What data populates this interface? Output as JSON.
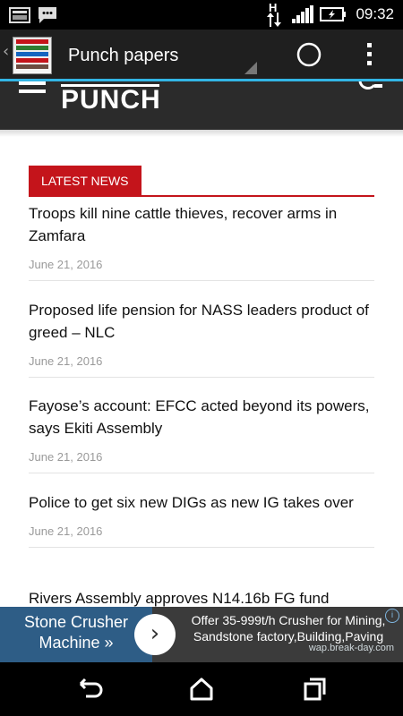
{
  "status_bar": {
    "time": "09:32",
    "signal_letter": "H",
    "icons": [
      "screenshot-icon",
      "chat-icon",
      "data-arrows-icon",
      "signal-icon",
      "battery-icon"
    ]
  },
  "action_bar": {
    "title": "Punch papers",
    "icons": [
      "app-thumbnail-icon",
      "refresh-circle-icon",
      "overflow-menu-icon"
    ]
  },
  "site_header": {
    "logo": "PUNCH",
    "icons": [
      "hamburger-menu-icon",
      "search-icon"
    ]
  },
  "section": {
    "label": "LATEST NEWS"
  },
  "articles": [
    {
      "headline": "Troops kill nine cattle thieves, recover arms in Zamfara",
      "date": "June 21, 2016"
    },
    {
      "headline": "Proposed life pension for NASS leaders product of greed – NLC",
      "date": "June 21, 2016"
    },
    {
      "headline": "Fayose’s account: EFCC acted beyond its powers, says Ekiti Assembly",
      "date": "June 21, 2016"
    },
    {
      "headline": "Police to get six new DIGs as new IG takes over",
      "date": "June 21, 2016"
    },
    {
      "headline": "Rivers Assembly approves N14.16b FG fund",
      "date": ""
    }
  ],
  "ad": {
    "left_text_line1": "Stone Crusher",
    "left_text_line2": "Machine »",
    "right_text_line1": "Offer 35-999t/h Crusher for Mining,",
    "right_text_line2": "Sandstone factory,Building,Paving",
    "url": "wap.break-day.com",
    "button_glyph": "›",
    "info_glyph": "i"
  },
  "nav_bar": {
    "icons": [
      "back-icon",
      "home-icon",
      "recent-apps-icon"
    ]
  },
  "colors": {
    "accent_red": "#c4141b",
    "action_bar_accent": "#33b5e5",
    "header_bg": "#2b2b2b"
  }
}
